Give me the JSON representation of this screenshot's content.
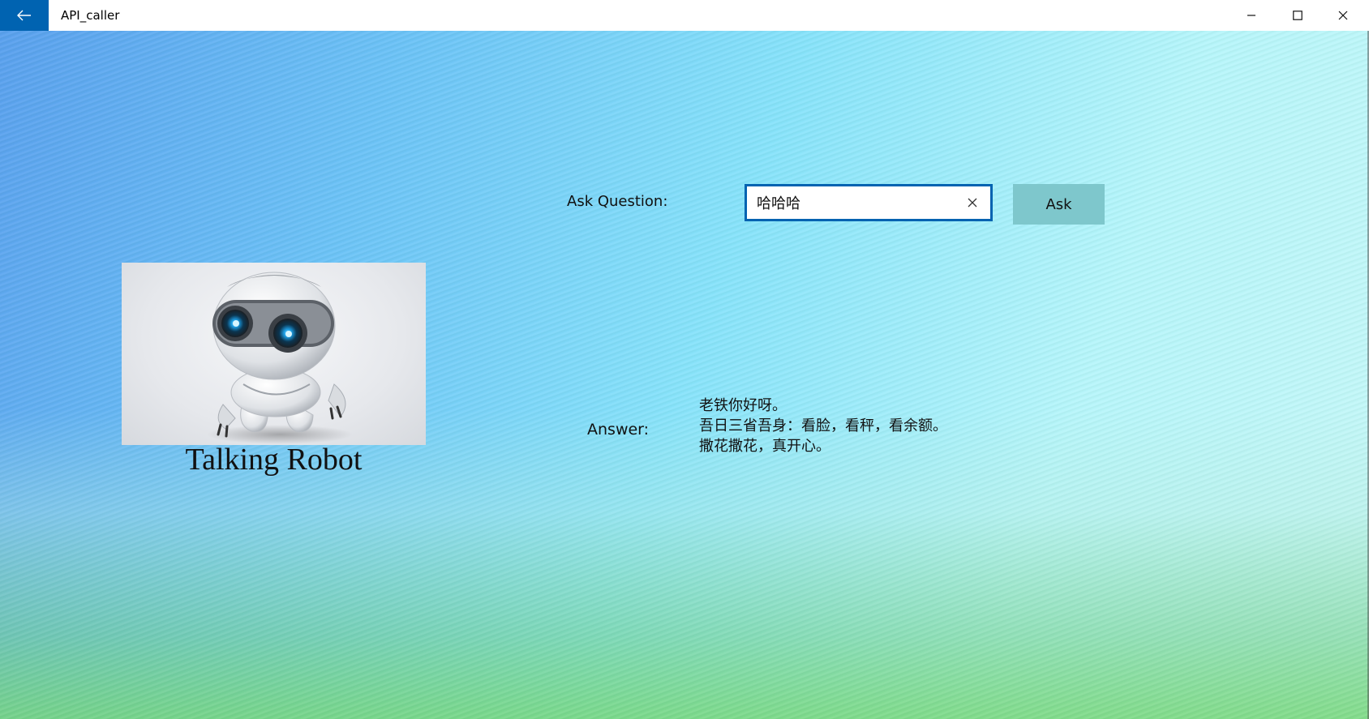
{
  "window": {
    "title": "API_caller"
  },
  "icons": {
    "back": "back-arrow-icon",
    "minimize": "minimize-icon",
    "maximize": "maximize-icon",
    "close": "close-icon",
    "clear": "clear-x-icon"
  },
  "colors": {
    "accent": "#0063b1",
    "ask_button": "#7ec7cc"
  },
  "form": {
    "ask_label": "Ask Question:",
    "question_value": "哈哈哈",
    "ask_button_label": "Ask"
  },
  "robot": {
    "caption": "Talking Robot"
  },
  "answer": {
    "label": "Answer:",
    "lines": [
      "老铁你好呀。",
      "吾日三省吾身：看脸，看秤，看余额。",
      "撒花撒花，真开心。"
    ]
  }
}
